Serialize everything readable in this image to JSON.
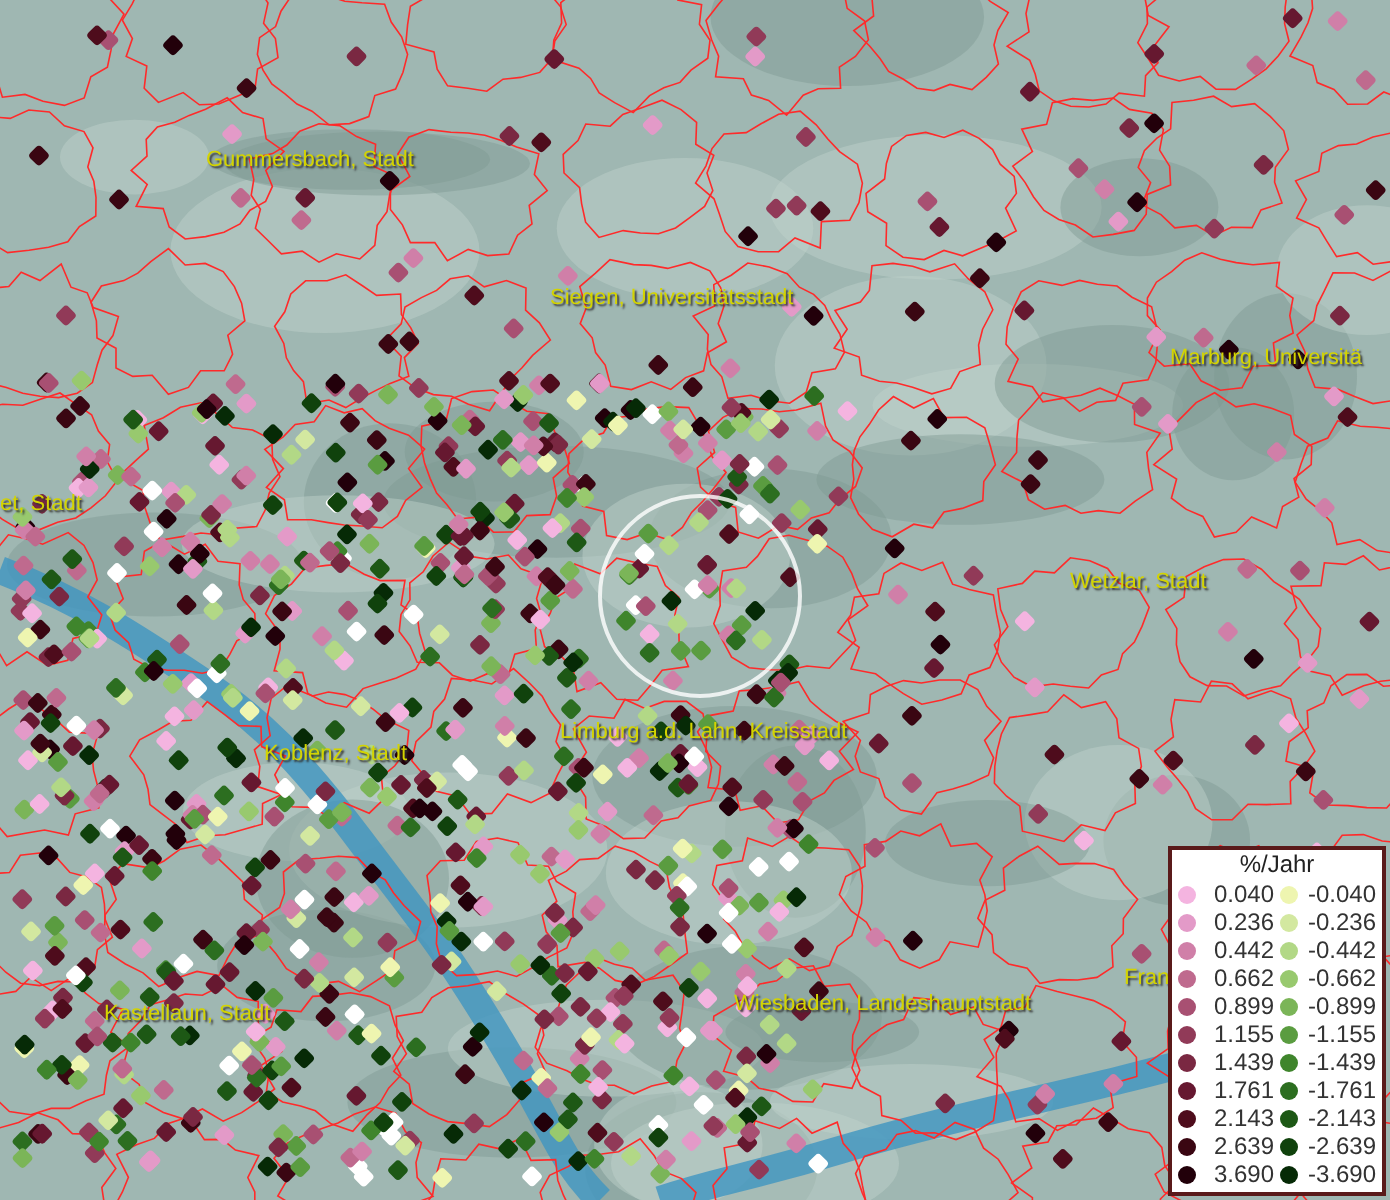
{
  "map": {
    "places": [
      {
        "name": "Gummersbach, Stadt"
      },
      {
        "name": "Siegen, Universitätsstadt"
      },
      {
        "name": "Marburg, Universitä"
      },
      {
        "name": "et, Stadt"
      },
      {
        "name": "Wetzlar, Stadt"
      },
      {
        "name": "Koblenz, Stadt"
      },
      {
        "name": "Limburg a.d. Lahn, Kreisstadt"
      },
      {
        "name": "Kastellaun, Stadt"
      },
      {
        "name": "Wiesbaden, Landeshauptstadt"
      },
      {
        "name": "Fran"
      }
    ]
  },
  "legend": {
    "title": "%/Jahr",
    "positive": [
      {
        "label": "0.040",
        "color": "#f4b4e0"
      },
      {
        "label": "0.236",
        "color": "#e39ac8"
      },
      {
        "label": "0.442",
        "color": "#d07fa8"
      },
      {
        "label": "0.662",
        "color": "#bf6a8e"
      },
      {
        "label": "0.899",
        "color": "#a85072"
      },
      {
        "label": "1.155",
        "color": "#913a58"
      },
      {
        "label": "1.439",
        "color": "#7a2842"
      },
      {
        "label": "1.761",
        "color": "#661830"
      },
      {
        "label": "2.143",
        "color": "#4e0c1c"
      },
      {
        "label": "2.639",
        "color": "#3a0612"
      },
      {
        "label": "3.690",
        "color": "#22000a"
      }
    ],
    "negative": [
      {
        "label": "-0.040",
        "color": "#eef5b0"
      },
      {
        "label": "-0.236",
        "color": "#d3e8a0"
      },
      {
        "label": "-0.442",
        "color": "#b2d886"
      },
      {
        "label": "-0.662",
        "color": "#98c96e"
      },
      {
        "label": "-0.899",
        "color": "#7bb558"
      },
      {
        "label": "-1.155",
        "color": "#5a9c40"
      },
      {
        "label": "-1.439",
        "color": "#3f852c"
      },
      {
        "label": "-1.761",
        "color": "#2c6e20"
      },
      {
        "label": "-2.143",
        "color": "#1d5815"
      },
      {
        "label": "-2.639",
        "color": "#10420c"
      },
      {
        "label": "-3.690",
        "color": "#062a06"
      }
    ]
  }
}
